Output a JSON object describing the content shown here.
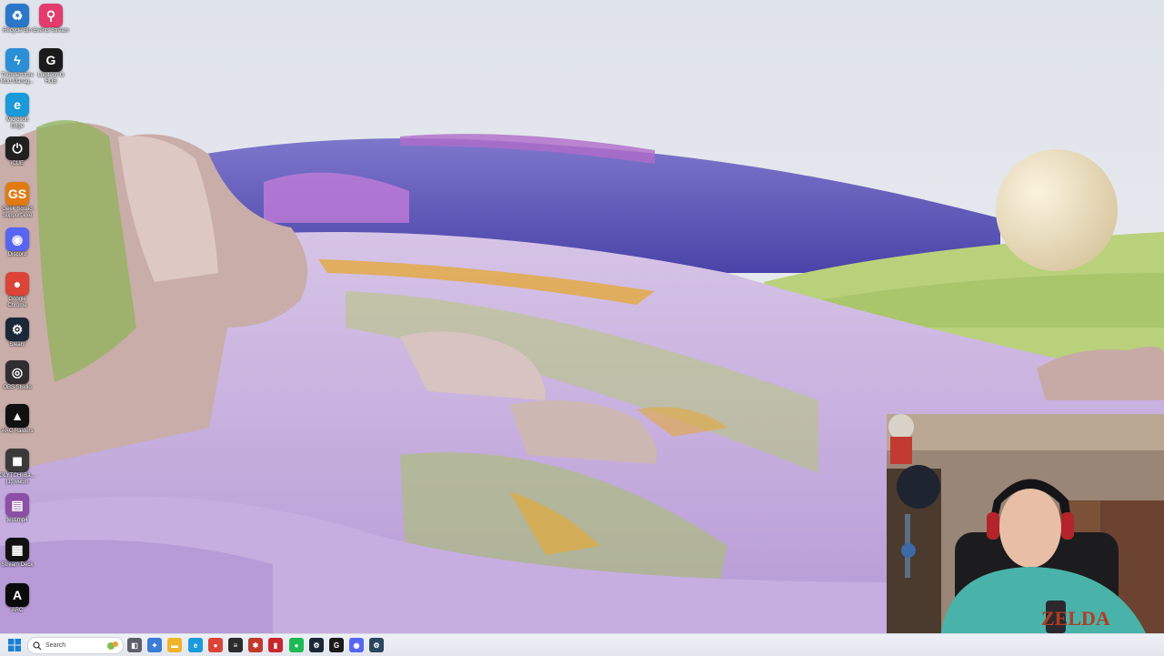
{
  "desktop": {
    "icons": [
      {
        "name": "recycle-bin-icon",
        "label": "Recycle Bin",
        "glyph": "♻",
        "color": "#2a77c9"
      },
      {
        "name": "events-stream-icon",
        "label": "Events Stream",
        "glyph": "⚲",
        "color": "#e23b6c"
      },
      {
        "name": "thunderstore-icon",
        "label": "Thunderstore Mod Manag...",
        "glyph": "ϟ",
        "color": "#2b8fd6"
      },
      {
        "name": "logitech-g-hub-icon",
        "label": "Logitech G HUB",
        "glyph": "G",
        "color": "#1b1b1b"
      },
      {
        "name": "edge-icon",
        "label": "Microsoft Edge",
        "glyph": "e",
        "color": "#1a9ad8"
      },
      {
        "name": "icue-icon",
        "label": "iCUE",
        "glyph": "⏻",
        "color": "#202020"
      },
      {
        "name": "geek-squad-icon",
        "label": "Geek Squad Support.exe",
        "glyph": "GS",
        "color": "#e07a12"
      },
      {
        "name": "discord-icon",
        "label": "Discord",
        "glyph": "◉",
        "color": "#5865f2"
      },
      {
        "name": "chrome-icon",
        "label": "Google Chrome",
        "glyph": "●",
        "color": "#db4437"
      },
      {
        "name": "steam-icon",
        "label": "Steam",
        "glyph": "⚙",
        "color": "#1b2838"
      },
      {
        "name": "obs-icon",
        "label": "OBS Studio",
        "glyph": "◎",
        "color": "#302e31"
      },
      {
        "name": "arc-raiders-icon",
        "label": "ARC Raiders",
        "glyph": "▲",
        "color": "#111111"
      },
      {
        "name": "glytch-icon",
        "label": "GLYTCH_Ba... (1).webm",
        "glyph": "◼",
        "color": "#3a3a3a"
      },
      {
        "name": "file-icon",
        "label": "test.mp4",
        "glyph": "▤",
        "color": "#8c4fa6"
      },
      {
        "name": "stream-deck-icon",
        "label": "Stream Deck",
        "glyph": "▦",
        "color": "#111111"
      },
      {
        "name": "arc-icon",
        "label": "ARC",
        "glyph": "A",
        "color": "#0b0b0b"
      }
    ]
  },
  "taskbar": {
    "search_placeholder": "Search",
    "apps": [
      {
        "name": "task-view-icon",
        "glyph": "◧",
        "color": "#5c5f6a"
      },
      {
        "name": "copilot-icon",
        "glyph": "✦",
        "color": "#3a7bd5"
      },
      {
        "name": "file-explorer-icon",
        "glyph": "▬",
        "color": "#f0b429"
      },
      {
        "name": "edge-taskbar-icon",
        "glyph": "e",
        "color": "#1a9ad8"
      },
      {
        "name": "chrome-taskbar-icon",
        "glyph": "●",
        "color": "#db4437"
      },
      {
        "name": "epic-games-icon",
        "glyph": "≡",
        "color": "#2b2b2b"
      },
      {
        "name": "spider-app-icon",
        "glyph": "✱",
        "color": "#c0392b"
      },
      {
        "name": "app-red-icon",
        "glyph": "▮",
        "color": "#c9252c"
      },
      {
        "name": "spotify-icon",
        "glyph": "●",
        "color": "#1db954"
      },
      {
        "name": "steam-taskbar-icon",
        "glyph": "⚙",
        "color": "#1b2838"
      },
      {
        "name": "g-hub-taskbar-icon",
        "glyph": "G",
        "color": "#1b1b1b"
      },
      {
        "name": "discord-taskbar-icon",
        "glyph": "◉",
        "color": "#5865f2"
      },
      {
        "name": "steam-2-taskbar-icon",
        "glyph": "⚙",
        "color": "#2a475e"
      }
    ]
  },
  "webcam": {
    "shirt_text": "ZELDA"
  }
}
